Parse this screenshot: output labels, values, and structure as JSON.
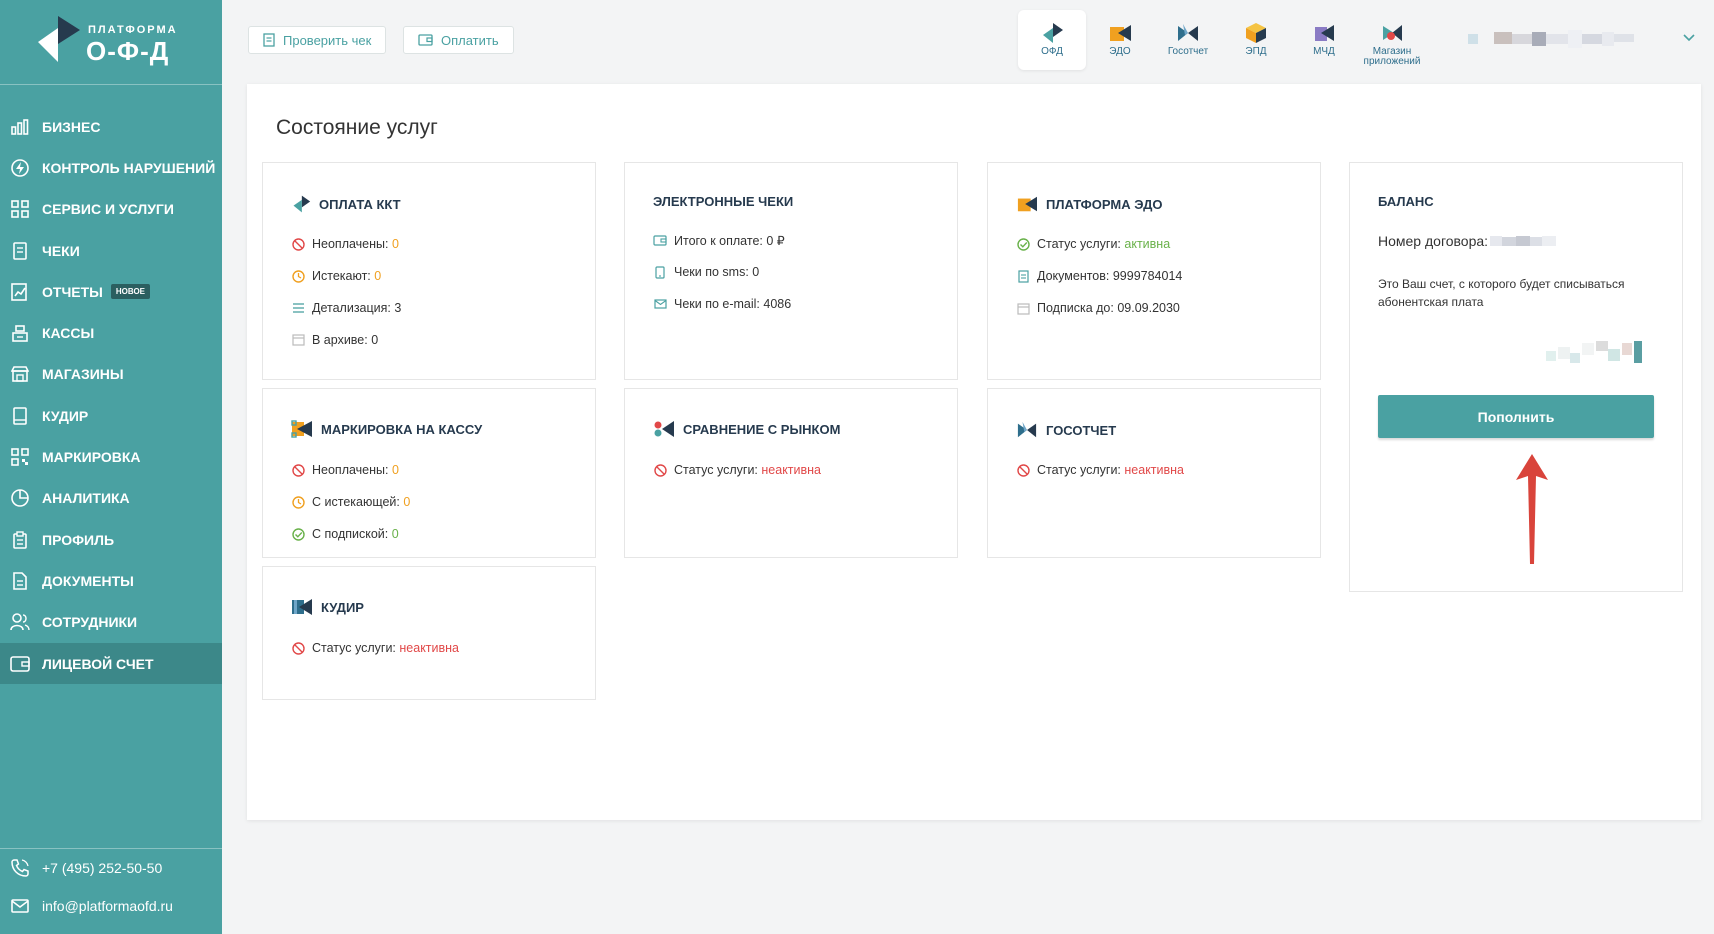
{
  "brand": {
    "line1": "ПЛАТФОРМА",
    "line2": "О-Ф-Д",
    "color": "#4aa1a2"
  },
  "sidebar": {
    "items": [
      {
        "label": "Бизнес",
        "icon": "bar-chart-icon"
      },
      {
        "label": "Контроль нарушений",
        "icon": "bolt-icon"
      },
      {
        "label": "Сервис и услуги",
        "icon": "grid-icon"
      },
      {
        "label": "Чеки",
        "icon": "receipt-icon"
      },
      {
        "label": "Отчеты",
        "icon": "report-icon",
        "badge": "НОВОЕ"
      },
      {
        "label": "Кассы",
        "icon": "cash-register-icon"
      },
      {
        "label": "Магазины",
        "icon": "store-icon"
      },
      {
        "label": "КУДиР",
        "icon": "book-icon"
      },
      {
        "label": "Маркировка",
        "icon": "qr-icon"
      },
      {
        "label": "Аналитика",
        "icon": "pie-icon"
      },
      {
        "label": "Профиль",
        "icon": "clipboard-icon"
      },
      {
        "label": "Документы",
        "icon": "document-icon"
      },
      {
        "label": "Сотрудники",
        "icon": "users-icon"
      },
      {
        "label": "Лицевой счет",
        "icon": "wallet-icon",
        "active": true
      }
    ],
    "phone": "+7 (495) 252-50-50",
    "email": "info@platformaofd.ru"
  },
  "topbar": {
    "check_receipt": "Проверить чек",
    "pay": "Оплатить",
    "apps": [
      {
        "label": "ОФД",
        "active": true
      },
      {
        "label": "ЭДО"
      },
      {
        "label": "Госотчет"
      },
      {
        "label": "ЭПД"
      },
      {
        "label": "МЧД"
      },
      {
        "label": "Магазин приложений"
      }
    ]
  },
  "main": {
    "title": "Состояние услуг",
    "cards": {
      "kkt": {
        "title": "Оплата ККТ",
        "unpaid_label": "Неоплачены:",
        "unpaid": "0",
        "expiring_label": "Истекают:",
        "expiring": "0",
        "detail": "Детализация: 3",
        "archive": "В архиве: 0"
      },
      "echecks": {
        "title": "Электронные чеки",
        "total": "Итого к оплате: 0 ₽",
        "sms": "Чеки по sms: 0",
        "email": "Чеки по e-mail: 4086"
      },
      "edo": {
        "title": "Платформа ЭДО",
        "status_label": "Статус услуги:",
        "status": "активна",
        "docs": "Документов: 9999784014",
        "sub": "Подписка до: 09.09.2030"
      },
      "balance": {
        "title": "Баланс",
        "contract_label": "Номер договора:",
        "note": "Это Ваш счет, с которого будет списываться абонентская плата",
        "button": "Пополнить"
      },
      "marking": {
        "title": "Маркировка на кассу",
        "unpaid_label": "Неоплачены:",
        "unpaid": "0",
        "expiring_label": "С истекающей:",
        "expiring": "0",
        "sub_label": "С подпиской:",
        "sub": "0"
      },
      "market": {
        "title": "Сравнение с рынком",
        "status_label": "Статус услуги:",
        "status": "неактивна"
      },
      "gos": {
        "title": "Госотчет",
        "status_label": "Статус услуги:",
        "status": "неактивна"
      },
      "kudir": {
        "title": "КУДиР",
        "status_label": "Статус услуги:",
        "status": "неактивна"
      }
    }
  },
  "colors": {
    "teal": "#4aa1a2",
    "orange": "#f0a020",
    "green": "#69b14a",
    "red": "#e14848",
    "navy": "#263a4e",
    "arrow": "#d9443b"
  }
}
